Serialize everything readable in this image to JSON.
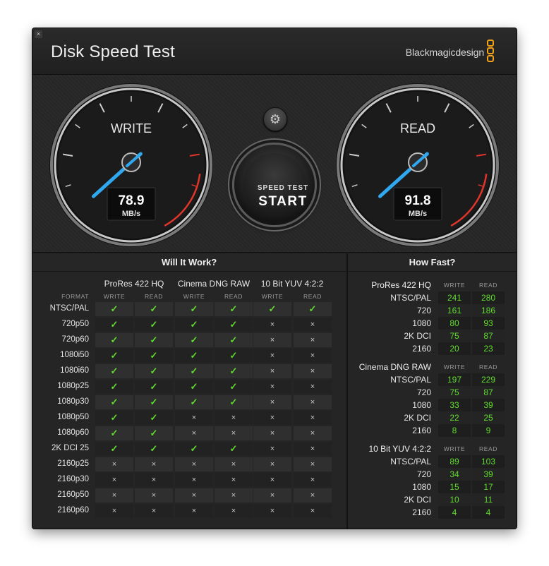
{
  "window": {
    "title": "Disk Speed Test",
    "brand": "Blackmagicdesign",
    "close_glyph": "×"
  },
  "gauges": {
    "write": {
      "label": "WRITE",
      "value": "78.9",
      "unit": "MB/s"
    },
    "read": {
      "label": "READ",
      "value": "91.8",
      "unit": "MB/s"
    }
  },
  "start_button": {
    "line1": "SPEED TEST",
    "line2": "START"
  },
  "settings_icon": "gear-icon",
  "will_it_work": {
    "title": "Will It Work?",
    "format_header": "FORMAT",
    "groups": [
      "ProRes 422 HQ",
      "Cinema DNG RAW",
      "10 Bit YUV 4:2:2"
    ],
    "subheaders": [
      "WRITE",
      "READ"
    ],
    "rows": [
      {
        "format": "NTSC/PAL",
        "r": [
          1,
          1,
          1,
          1,
          1,
          1
        ]
      },
      {
        "format": "720p50",
        "r": [
          1,
          1,
          1,
          1,
          0,
          0
        ]
      },
      {
        "format": "720p60",
        "r": [
          1,
          1,
          1,
          1,
          0,
          0
        ]
      },
      {
        "format": "1080i50",
        "r": [
          1,
          1,
          1,
          1,
          0,
          0
        ]
      },
      {
        "format": "1080i60",
        "r": [
          1,
          1,
          1,
          1,
          0,
          0
        ]
      },
      {
        "format": "1080p25",
        "r": [
          1,
          1,
          1,
          1,
          0,
          0
        ]
      },
      {
        "format": "1080p30",
        "r": [
          1,
          1,
          1,
          1,
          0,
          0
        ]
      },
      {
        "format": "1080p50",
        "r": [
          1,
          1,
          0,
          0,
          0,
          0
        ]
      },
      {
        "format": "1080p60",
        "r": [
          1,
          1,
          0,
          0,
          0,
          0
        ]
      },
      {
        "format": "2K DCI 25",
        "r": [
          1,
          1,
          1,
          1,
          0,
          0
        ]
      },
      {
        "format": "2160p25",
        "r": [
          0,
          0,
          0,
          0,
          0,
          0
        ]
      },
      {
        "format": "2160p30",
        "r": [
          0,
          0,
          0,
          0,
          0,
          0
        ]
      },
      {
        "format": "2160p50",
        "r": [
          0,
          0,
          0,
          0,
          0,
          0
        ]
      },
      {
        "format": "2160p60",
        "r": [
          0,
          0,
          0,
          0,
          0,
          0
        ]
      }
    ],
    "check_glyph": "✓",
    "cross_glyph": "×"
  },
  "how_fast": {
    "title": "How Fast?",
    "col_headers": [
      "WRITE",
      "READ"
    ],
    "groups": [
      {
        "name": "ProRes 422 HQ",
        "rows": [
          {
            "format": "NTSC/PAL",
            "write": "241",
            "read": "280"
          },
          {
            "format": "720",
            "write": "161",
            "read": "186"
          },
          {
            "format": "1080",
            "write": "80",
            "read": "93"
          },
          {
            "format": "2K DCI",
            "write": "75",
            "read": "87"
          },
          {
            "format": "2160",
            "write": "20",
            "read": "23"
          }
        ]
      },
      {
        "name": "Cinema DNG RAW",
        "rows": [
          {
            "format": "NTSC/PAL",
            "write": "197",
            "read": "229"
          },
          {
            "format": "720",
            "write": "75",
            "read": "87"
          },
          {
            "format": "1080",
            "write": "33",
            "read": "39"
          },
          {
            "format": "2K DCI",
            "write": "22",
            "read": "25"
          },
          {
            "format": "2160",
            "write": "8",
            "read": "9"
          }
        ]
      },
      {
        "name": "10 Bit YUV 4:2:2",
        "rows": [
          {
            "format": "NTSC/PAL",
            "write": "89",
            "read": "103"
          },
          {
            "format": "720",
            "write": "34",
            "read": "39"
          },
          {
            "format": "1080",
            "write": "15",
            "read": "17"
          },
          {
            "format": "2K DCI",
            "write": "10",
            "read": "11"
          },
          {
            "format": "2160",
            "write": "4",
            "read": "4"
          }
        ]
      }
    ]
  },
  "colors": {
    "ok": "#5fdc2c",
    "needle": "#2fa8f0",
    "redline": "#e0352b",
    "brand_logo": "#f0a21b"
  }
}
